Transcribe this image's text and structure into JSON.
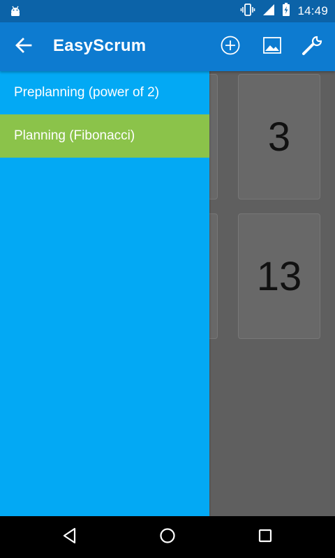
{
  "status_bar": {
    "time": "14:49",
    "icons": [
      "android-debug-icon",
      "vibrate-icon",
      "signal-icon",
      "battery-icon"
    ]
  },
  "app_bar": {
    "title": "EasyScrum",
    "actions": [
      "add-circle-icon",
      "image-icon",
      "wrench-icon"
    ]
  },
  "drawer": {
    "items": [
      {
        "label": "Preplanning (power of 2)",
        "selected": false
      },
      {
        "label": "Planning (Fibonacci)",
        "selected": true
      }
    ]
  },
  "cards": {
    "visible": [
      "3",
      "13"
    ]
  },
  "colors": {
    "status_bar": "#0c63a8",
    "app_bar": "#0d7bd0",
    "drawer": "#03a9f4",
    "selected_item": "#8bc34a",
    "background": "#5f5f5f"
  },
  "nav_bar": {
    "buttons": [
      "back-triangle-icon",
      "home-circle-icon",
      "recents-square-icon"
    ]
  }
}
